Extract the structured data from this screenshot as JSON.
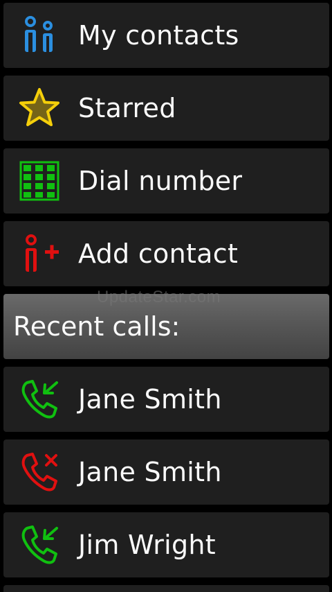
{
  "menu": [
    {
      "label": "My contacts",
      "icon": "contacts-icon",
      "color": "#2b8fe0"
    },
    {
      "label": "Starred",
      "icon": "star-icon",
      "color": "#f5cf0a"
    },
    {
      "label": "Dial number",
      "icon": "dialpad-icon",
      "color": "#10c010"
    },
    {
      "label": "Add contact",
      "icon": "add-contact-icon",
      "color": "#e01010"
    }
  ],
  "recent_header": "Recent calls:",
  "recent_calls": [
    {
      "name": "Jane Smith",
      "type": "incoming",
      "icon": "incoming-call-icon",
      "color": "#10c010"
    },
    {
      "name": "Jane Smith",
      "type": "missed",
      "icon": "missed-call-icon",
      "color": "#e01010"
    },
    {
      "name": "Jim Wright",
      "type": "incoming",
      "icon": "incoming-call-icon",
      "color": "#10c010"
    }
  ],
  "watermark": "UpdateStar.com"
}
